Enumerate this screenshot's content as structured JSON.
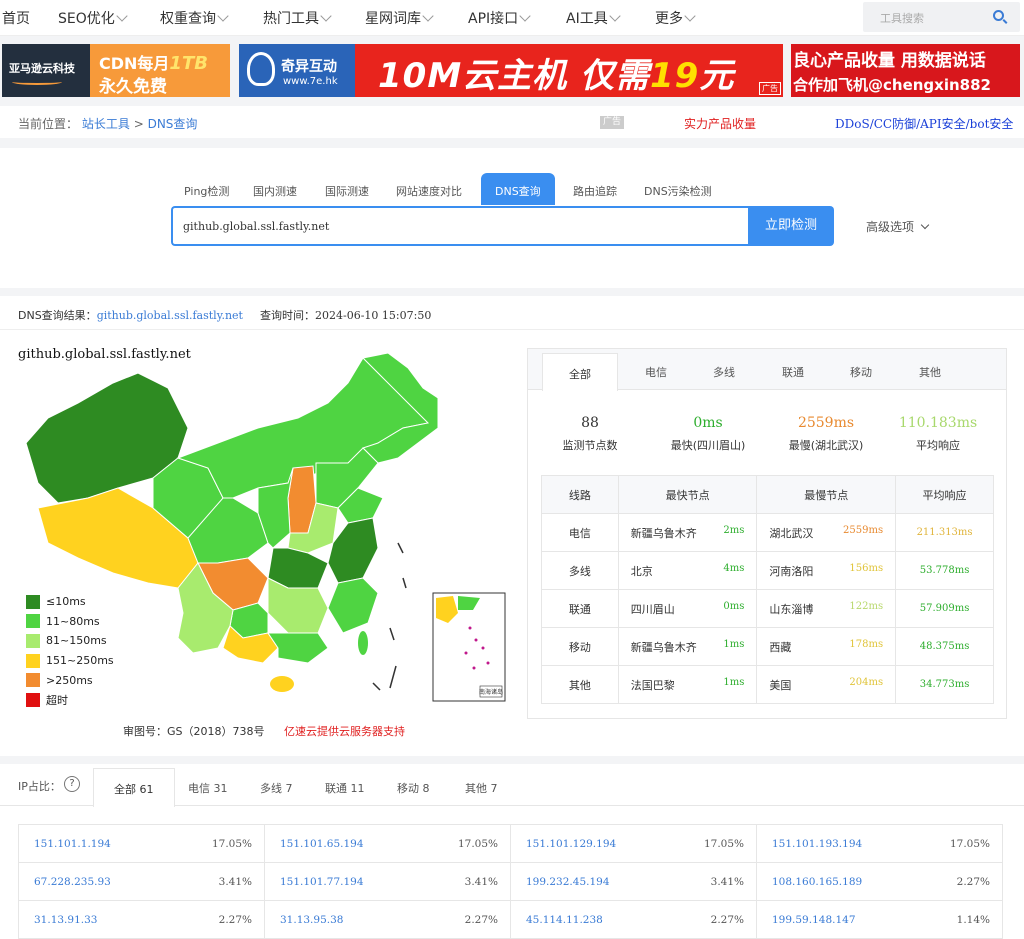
{
  "topnav": {
    "items": [
      {
        "label": "首页",
        "dropdown": false
      },
      {
        "label": "SEO优化",
        "dropdown": true
      },
      {
        "label": "权重查询",
        "dropdown": true
      },
      {
        "label": "热门工具",
        "dropdown": true
      },
      {
        "label": "星网词库",
        "dropdown": true
      },
      {
        "label": "API接口",
        "dropdown": true
      },
      {
        "label": "AI工具",
        "dropdown": true
      },
      {
        "label": "更多",
        "dropdown": true
      }
    ],
    "search_placeholder": "工具搜索"
  },
  "ads": {
    "ad1": {
      "brand": "亚马逊云科技",
      "line1_prefix": "CDN每月",
      "line1_highlight": "1TB",
      "line2": "永久免费"
    },
    "ad2": {
      "logo_name": "奇异互动",
      "logo_url": "www.7e.hk",
      "text_a": "10M云主机 仅需",
      "text_b": "19",
      "text_c": "元",
      "mark": "广告"
    },
    "ad3": {
      "line1": "良心产品收量 用数据说话",
      "line2": "合作加飞机@chengxin882"
    }
  },
  "breadcrumb": {
    "prefix": "当前位置：",
    "items": [
      "站长工具",
      "DNS查询"
    ],
    "separator": ">",
    "ad_tag": "广告",
    "red_link": "实力产品收量",
    "blue_link": "DDoS/CC防御/API安全/bot安全"
  },
  "tool": {
    "tabs": [
      "Ping检测",
      "国内测速",
      "国际测速",
      "网站速度对比",
      "DNS查询",
      "路由追踪",
      "DNS污染检测"
    ],
    "active_tab": "DNS查询",
    "input_value": "github.global.ssl.fastly.net",
    "submit_label": "立即检测",
    "advanced_label": "高级选项"
  },
  "result": {
    "label": "DNS查询结果：",
    "domain": "github.global.ssl.fastly.net",
    "time_label": "查询时间：",
    "time": "2024-06-10 15:07:50",
    "map_title": "github.global.ssl.fastly.net",
    "legend": [
      {
        "label": "≤10ms",
        "color": "#2e8b22"
      },
      {
        "label": "11~80ms",
        "color": "#4fd442"
      },
      {
        "label": "81~150ms",
        "color": "#a8eb6e"
      },
      {
        "label": "151~250ms",
        "color": "#ffd21f"
      },
      {
        "label": ">250ms",
        "color": "#f28c30"
      },
      {
        "label": "超时",
        "color": "#e01010"
      }
    ],
    "approval": "审图号：GS（2018）738号",
    "sponsor": "亿速云提供云服务器支持",
    "nanhai_label": "南海诸岛"
  },
  "stats": {
    "tabs": [
      "全部",
      "电信",
      "多线",
      "联通",
      "移动",
      "其他"
    ],
    "active_tab": "全部",
    "summary": [
      {
        "value": "88",
        "label": "监测节点数",
        "color": "#333333"
      },
      {
        "value": "0ms",
        "label": "最快(四川眉山)",
        "color": "#2eae2e"
      },
      {
        "value": "2559ms",
        "label": "最慢(湖北武汉)",
        "color": "#e88a30"
      },
      {
        "value": "110.183ms",
        "label": "平均响应",
        "color": "#a8d86c"
      }
    ],
    "headers": [
      "线路",
      "最快节点",
      "最慢节点",
      "平均响应"
    ],
    "rows": [
      {
        "line": "电信",
        "fast_node": "新疆乌鲁木齐",
        "fast_ms": "2ms",
        "slow_node": "湖北武汉",
        "slow_ms": "2559ms",
        "avg": "211.313ms"
      },
      {
        "line": "多线",
        "fast_node": "北京",
        "fast_ms": "4ms",
        "slow_node": "河南洛阳",
        "slow_ms": "156ms",
        "avg": "53.778ms"
      },
      {
        "line": "联通",
        "fast_node": "四川眉山",
        "fast_ms": "0ms",
        "slow_node": "山东淄博",
        "slow_ms": "122ms",
        "avg": "57.909ms"
      },
      {
        "line": "移动",
        "fast_node": "新疆乌鲁木齐",
        "fast_ms": "1ms",
        "slow_node": "西藏",
        "slow_ms": "178ms",
        "avg": "48.375ms"
      },
      {
        "line": "其他",
        "fast_node": "法国巴黎",
        "fast_ms": "1ms",
        "slow_node": "美国",
        "slow_ms": "204ms",
        "avg": "34.773ms"
      }
    ],
    "colors": {
      "fast": "#2eae2e",
      "slow_orange": "#e88a30",
      "slow_yellow": "#e0c43a",
      "avg_green": "#2eae2e",
      "avg_yellow": "#e0b43a"
    }
  },
  "ip": {
    "label": "IP占比：",
    "help": "?",
    "tabs": [
      "全部 61",
      "电信 31",
      "多线 7",
      "联通 11",
      "移动 8",
      "其他 7"
    ],
    "active_tab": "全部 61",
    "cells": [
      {
        "ip": "151.101.1.194",
        "pct": "17.05%"
      },
      {
        "ip": "151.101.65.194",
        "pct": "17.05%"
      },
      {
        "ip": "151.101.129.194",
        "pct": "17.05%"
      },
      {
        "ip": "151.101.193.194",
        "pct": "17.05%"
      },
      {
        "ip": "67.228.235.93",
        "pct": "3.41%"
      },
      {
        "ip": "151.101.77.194",
        "pct": "3.41%"
      },
      {
        "ip": "199.232.45.194",
        "pct": "3.41%"
      },
      {
        "ip": "108.160.165.189",
        "pct": "2.27%"
      },
      {
        "ip": "31.13.91.33",
        "pct": "2.27%"
      },
      {
        "ip": "31.13.95.38",
        "pct": "2.27%"
      },
      {
        "ip": "45.114.11.238",
        "pct": "2.27%"
      },
      {
        "ip": "199.59.148.147",
        "pct": "1.14%"
      }
    ]
  }
}
